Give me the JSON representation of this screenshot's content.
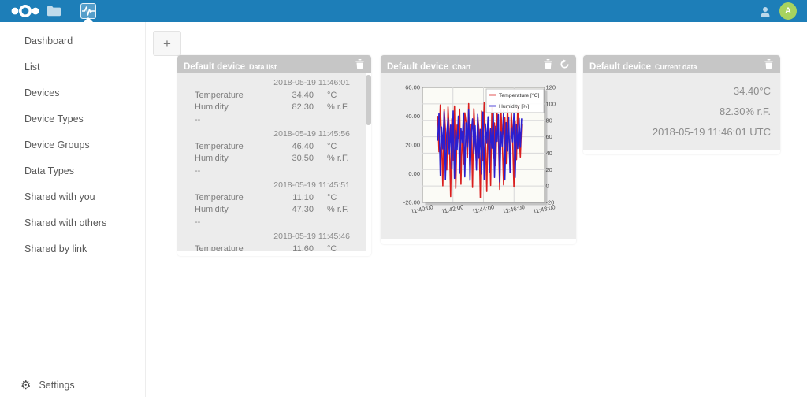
{
  "header": {
    "brand": "Nextcloud",
    "apps": [
      {
        "name": "files"
      },
      {
        "name": "sensorlogger",
        "active": true
      }
    ],
    "avatar_letter": "A"
  },
  "sidebar": {
    "items": [
      "Dashboard",
      "List",
      "Devices",
      "Device Types",
      "Device Groups",
      "Data Types",
      "Shared with you",
      "Shared with others",
      "Shared by link"
    ],
    "settings_label": "Settings"
  },
  "main": {
    "add_button_label": "+"
  },
  "cards": {
    "data_list": {
      "title": "Default device",
      "subtitle": "Data list",
      "groups": [
        {
          "timestamp": "2018-05-19 11:46:01",
          "rows": [
            {
              "name": "Temperature",
              "value": "34.40",
              "unit": "°C"
            },
            {
              "name": "Humidity",
              "value": "82.30",
              "unit": "% r.F."
            }
          ],
          "footer": "--"
        },
        {
          "timestamp": "2018-05-19 11:45:56",
          "rows": [
            {
              "name": "Temperature",
              "value": "46.40",
              "unit": "°C"
            },
            {
              "name": "Humidity",
              "value": "30.50",
              "unit": "% r.F."
            }
          ],
          "footer": "--"
        },
        {
          "timestamp": "2018-05-19 11:45:51",
          "rows": [
            {
              "name": "Temperature",
              "value": "11.10",
              "unit": "°C"
            },
            {
              "name": "Humidity",
              "value": "47.30",
              "unit": "% r.F."
            }
          ],
          "footer": "--"
        },
        {
          "timestamp": "2018-05-19 11:45:46",
          "rows": [
            {
              "name": "Temperature",
              "value": "11.60",
              "unit": "°C"
            }
          ]
        }
      ]
    },
    "chart": {
      "title": "Default device",
      "subtitle": "Chart"
    },
    "current": {
      "title": "Default device",
      "subtitle": "Current data",
      "lines": [
        "34.40°C",
        "82.30% r.F.",
        "2018-05-19 11:46:01 UTC"
      ]
    }
  },
  "chart_data": {
    "type": "line",
    "title": "",
    "xlabel": "",
    "ylabel_left": "Temperature [°C]",
    "ylabel_right": "Humidity [%]",
    "x_ticks": [
      "11:40:00",
      "11:42:00",
      "11:44:00",
      "11:46:00",
      "11:48:00"
    ],
    "y_left_ticks": [
      "60.00",
      "40.00",
      "20.00",
      "0.00",
      "-20.00"
    ],
    "y_left_range": [
      -20,
      60
    ],
    "y_right_ticks": [
      "120",
      "100",
      "80",
      "60",
      "40",
      "20",
      "0",
      "-20"
    ],
    "y_right_range": [
      -20,
      120
    ],
    "x_data_range_fraction": [
      0.125,
      0.8125
    ],
    "x_data_span": "11:41:00 to 11:46:30, 5s interval",
    "grid": true,
    "legend_position": "top-right",
    "series": [
      {
        "name": "Temperature [°C]",
        "axis": "left",
        "color": "#da1f1f",
        "values": [
          40.2,
          15.3,
          47.8,
          22.1,
          -8.4,
          44.6,
          31.0,
          2.7,
          46.4,
          28.3,
          -15.9,
          38.2,
          9.5,
          47.1,
          -10.2,
          33.8,
          24.6,
          44.9,
          -7.3,
          29.5,
          6.8,
          42.3,
          36.1,
          11.1,
          48.7,
          1.4,
          34.4,
          -9.6,
          45.2,
          26.7,
          4.3,
          39.8,
          30.2,
          -16.8,
          43.5,
          8.9,
          49.3,
          25.1,
          -12.4,
          37.6,
          28.9,
          -8.1,
          46.0,
          10.7,
          35.3,
          5.6,
          41.8,
          27.4,
          -10.9,
          44.1,
          23.8,
          -7.7,
          38.9,
          7.2,
          45.7,
          29.9,
          3.5,
          42.7,
          24.3,
          -9.2,
          36.7,
          9.8,
          47.5,
          26.2,
          11.6,
          34.4
        ]
      },
      {
        "name": "Humidity [%]",
        "axis": "right",
        "color": "#2a1fd0",
        "values": [
          55.2,
          88.4,
          12.7,
          71.9,
          45.3,
          90.6,
          7.8,
          63.1,
          82.3,
          38.5,
          74.2,
          20.8,
          91.3,
          9.4,
          67.7,
          43.9,
          85.1,
          15.6,
          70.3,
          52.4,
          88.9,
          11.2,
          76.8,
          47.3,
          92.5,
          6.9,
          64.5,
          81.7,
          39.8,
          73.4,
          19.6,
          87.2,
          33.8,
          68.9,
          14.7,
          90.1,
          8.3,
          75.6,
          51.9,
          84.3,
          17.2,
          69.8,
          46.1,
          89.5,
          10.5,
          72.7,
          54.3,
          86.8,
          4.9,
          66.4,
          48.2,
          91.8,
          7.5,
          77.3,
          42.6,
          83.6,
          16.4,
          71.2,
          53.7,
          88.1,
          10.5,
          74.9,
          45.8,
          82.3,
          47.3,
          82.3
        ]
      }
    ]
  },
  "colors": {
    "header_bg": "#1d7eb8",
    "avatar_bg": "#a8d35f",
    "card_header_bg": "#c6c6c6",
    "card_body_bg": "#ececec",
    "temperature_line": "#da1f1f",
    "humidity_line": "#2a1fd0",
    "chart_panel_bg": "#fbfbf6"
  }
}
